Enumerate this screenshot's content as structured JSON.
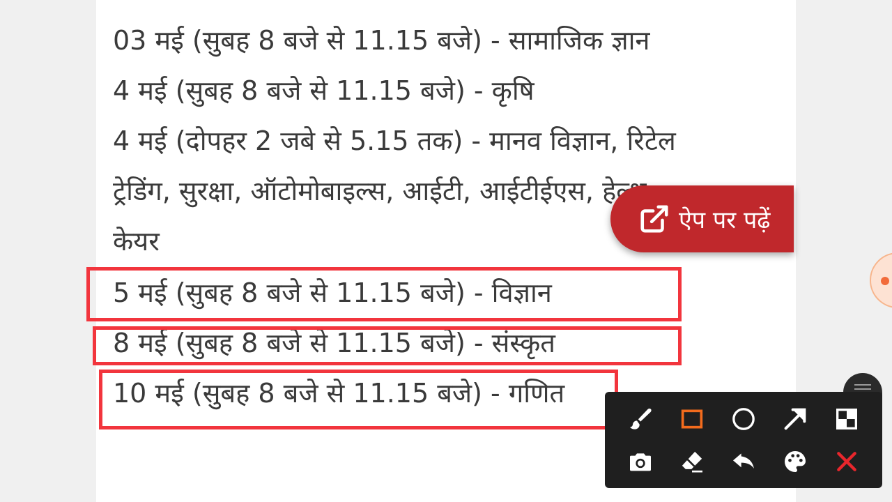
{
  "article": {
    "lines": [
      "03 मई (सुबह 8 बजे से 11.15 बजे) - सामाजिक ज्ञान",
      "4 मई (सुबह 8 बजे से 11.15 बजे) - कृषि",
      "4 मई (दोपहर 2 जबे से 5.15 तक) - मानव विज्ञान, रिटेल",
      "ट्रेडिंग, सुरक्षा, ऑटोमोबाइल्स, आईटी, आईटीईएस, हेल्थ",
      "केयर",
      "5 मई  (सुबह 8 बजे से 11.15 बजे) - विज्ञान",
      "8 मई (सुबह 8 बजे से 11.15 बजे) - संस्कृत",
      "10 मई (सुबह 8 बजे से 11.15 बजे) - गणित"
    ]
  },
  "read_in_app": {
    "label": "ऐप पर पढ़ें"
  },
  "annotation_toolbar": {
    "tools": [
      "brush-icon",
      "rectangle-icon",
      "circle-icon",
      "arrow-icon",
      "mosaic-icon",
      "camera-icon",
      "eraser-icon",
      "undo-icon",
      "palette-icon",
      "close-icon"
    ],
    "active_color": "#f26b1d",
    "close_color": "#e8262c"
  },
  "colors": {
    "highlight": "#f2353d",
    "button_bg": "#c0282c",
    "text": "#3a3a3a"
  }
}
